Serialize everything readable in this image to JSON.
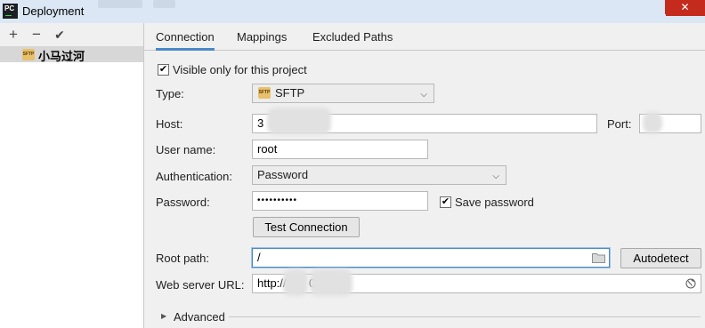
{
  "window": {
    "title": "Deployment",
    "app_icon_text": "PC",
    "close_glyph": "✕"
  },
  "toolbar": {
    "add_glyph": "+",
    "remove_glyph": "−",
    "apply_glyph": "✔"
  },
  "servers": [
    {
      "name": "小马过河",
      "badge": "SFTP"
    }
  ],
  "tabs": [
    {
      "label": "Connection",
      "active": true
    },
    {
      "label": "Mappings",
      "active": false
    },
    {
      "label": "Excluded Paths",
      "active": false
    }
  ],
  "form": {
    "visible_only_label": "Visible only for this project",
    "visible_only_checked": true,
    "type_label": "Type:",
    "type_value": "SFTP",
    "type_badge": "SFTP",
    "host_label": "Host:",
    "host_value": "3",
    "port_label": "Port:",
    "port_value": "",
    "username_label": "User name:",
    "username_value": "root",
    "auth_label": "Authentication:",
    "auth_value": "Password",
    "password_label": "Password:",
    "password_mask": "••••••••••",
    "save_password_label": "Save password",
    "save_password_checked": true,
    "test_connection_label": "Test Connection",
    "root_path_label": "Root path:",
    "root_path_value": "/",
    "autodetect_label": "Autodetect",
    "web_url_label": "Web server URL:",
    "web_url_value": "http://3",
    "web_url_tail": "0",
    "advanced_label": "Advanced"
  },
  "icons": {
    "check": "✔",
    "chevron_down": "⌵",
    "folder": "folder-icon",
    "globe": "globe-icon",
    "expand": "▶"
  }
}
